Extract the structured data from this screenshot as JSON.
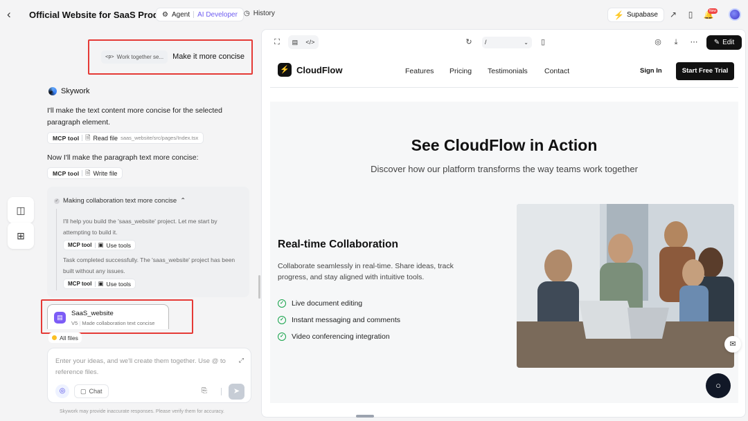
{
  "header": {
    "back_icon": "chevron-left-icon",
    "project_title": "Official Website for SaaS Product",
    "agent_label": "Agent",
    "agent_mode": "AI Developer",
    "history_label": "History",
    "supabase_label": "Supabase",
    "new_badge": "New"
  },
  "chat": {
    "user_message": {
      "element_tag": "<p>",
      "element_snippet": "Work together se...",
      "text": "Make it more concise"
    },
    "assistant_name": "Skywork",
    "msg1": "I'll make the text content more concise for the selected paragraph element.",
    "tool1": {
      "kind": "MCP tool",
      "action": "Read file",
      "path": "saas_website/src/pages/Index.tsx"
    },
    "msg2": "Now I'll make the paragraph text more concise:",
    "tool2": {
      "kind": "MCP tool",
      "action": "Write file"
    },
    "thinking": {
      "title": "Making collaboration text more concise",
      "text1": "I'll help you build the 'saas_website' project. Let me start by attempting to build it.",
      "tool_a": {
        "kind": "MCP tool",
        "action": "Use tools"
      },
      "text2": "Task completed successfully. The 'saas_website' project has been built without any issues.",
      "tool_b": {
        "kind": "MCP tool",
        "action": "Use tools"
      }
    },
    "version": {
      "name": "SaaS_website",
      "tag": "V5",
      "desc": "Made collaboration text concise"
    },
    "all_files": "All files",
    "composer": {
      "placeholder": "Enter your ideas, and we'll create them together. Use @ to reference files.",
      "chat_label": "Chat"
    },
    "disclaimer": "Skywork may provide inaccurate responses. Please verify them for accuracy."
  },
  "preview": {
    "path_value": "/",
    "edit_label": "Edit",
    "site": {
      "brand": "CloudFlow",
      "nav": [
        "Features",
        "Pricing",
        "Testimonials",
        "Contact"
      ],
      "signin": "Sign In",
      "cta": "Start Free Trial",
      "hero_title": "See CloudFlow in Action",
      "hero_sub": "Discover how our platform transforms the way teams work together",
      "feature_title": "Real-time Collaboration",
      "feature_desc": "Collaborate seamlessly in real-time. Share ideas, track progress, and stay aligned with intuitive tools.",
      "feature_items": [
        "Live document editing",
        "Instant messaging and comments",
        "Video conferencing integration"
      ]
    }
  },
  "colors": {
    "accent": "#6d5bf0",
    "check_green": "#16a34a",
    "annotation_red": "#e53935"
  }
}
